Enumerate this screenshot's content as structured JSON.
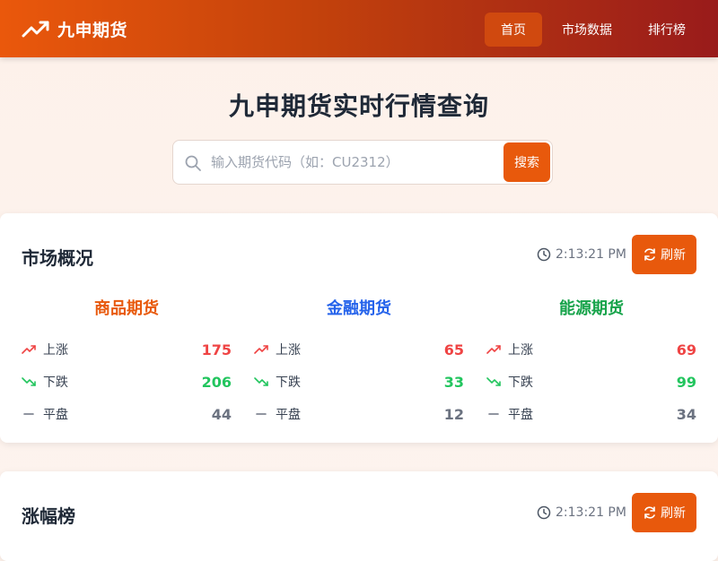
{
  "header": {
    "brand": "九申期货",
    "nav": [
      {
        "label": "首页",
        "active": true
      },
      {
        "label": "市场数据",
        "active": false
      },
      {
        "label": "排行榜",
        "active": false
      }
    ]
  },
  "hero": {
    "title": "九申期货实时行情查询",
    "search_placeholder": "输入期货代码（如：CU2312）",
    "search_button": "搜索"
  },
  "overview": {
    "title": "市场概况",
    "time": "2:13:21 PM",
    "refresh_label": "刷新",
    "categories": [
      {
        "name": "商品期货",
        "color": "#e8590c",
        "rows": [
          {
            "label": "上涨",
            "value": "175",
            "kind": "up"
          },
          {
            "label": "下跌",
            "value": "206",
            "kind": "down"
          },
          {
            "label": "平盘",
            "value": "44",
            "kind": "flat"
          }
        ]
      },
      {
        "name": "金融期货",
        "color": "#2563eb",
        "rows": [
          {
            "label": "上涨",
            "value": "65",
            "kind": "up"
          },
          {
            "label": "下跌",
            "value": "33",
            "kind": "down"
          },
          {
            "label": "平盘",
            "value": "12",
            "kind": "flat"
          }
        ]
      },
      {
        "name": "能源期货",
        "color": "#16a34a",
        "rows": [
          {
            "label": "上涨",
            "value": "69",
            "kind": "up"
          },
          {
            "label": "下跌",
            "value": "99",
            "kind": "down"
          },
          {
            "label": "平盘",
            "value": "34",
            "kind": "flat"
          }
        ]
      }
    ]
  },
  "gainers": {
    "title": "涨幅榜",
    "time": "2:13:21 PM",
    "refresh_label": "刷新"
  },
  "colors": {
    "up": "#ef4444",
    "down": "#22c55e",
    "flat": "#6b7280",
    "accent": "#e8590c"
  },
  "icons": {
    "brand": "trending-up-icon",
    "search": "search-icon",
    "clock": "clock-icon",
    "refresh": "refresh-icon",
    "up": "trending-up-icon",
    "down": "trending-down-icon",
    "flat": "minus-icon"
  }
}
